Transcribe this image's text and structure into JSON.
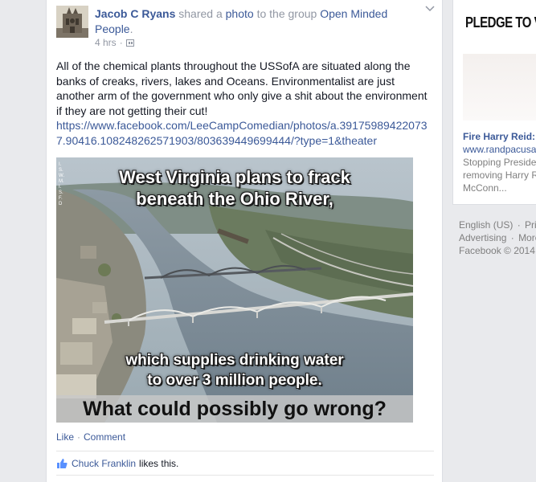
{
  "post": {
    "author": "Jacob C Ryans",
    "shared_text_1": "shared a",
    "photo_link": "photo",
    "shared_text_2": "to the group",
    "group_name": "Open Minded People",
    "group_suffix": ".",
    "time": "4 hrs",
    "body": "All of the chemical plants throughout the USSofA are situated along the banks of creaks, rivers, lakes and Oceans. Environmentalist are just another arm of the government who only give a shit about the environment if they are not getting their cut!",
    "url": "https://www.facebook.com/LeeCampComedian/photos/a.391759894220737.90416.108248262571903/803639449699444/?type=1&theater",
    "icons": {
      "chevron": "chevron-down-icon",
      "audience": "group-audience-icon",
      "like": "thumbs-up-icon"
    }
  },
  "photo": {
    "headline_line1": "West Virginia plans to frack",
    "headline_line2": "beneath the Ohio River,",
    "subtext_line1": "which supplies drinking water",
    "subtext_line2": "to over 3 million people.",
    "tagline": "What could possibly go wrong?",
    "watermark": "I.S.W.M.I.S.F.D"
  },
  "actions": {
    "like": "Like",
    "separator": "·",
    "comment": "Comment"
  },
  "likes": {
    "liker": "Chuck Franklin",
    "suffix": "likes this."
  },
  "sidebar_ad": {
    "image_text": "PLEDGE TO VOTE",
    "title": "Fire Harry Reid:",
    "url": "www.randpacusa",
    "desc_line1": "Stopping Preside",
    "desc_line2": "removing Harry R",
    "desc_line3": "McConn..."
  },
  "footer": {
    "language": "English (US)",
    "privacy": "Priv",
    "advertising": "Advertising",
    "more": "More",
    "copyright": "Facebook © 2014",
    "separator": "·"
  },
  "colors": {
    "link": "#3b5998",
    "background": "#e9eaed",
    "meta_gray": "#9197a3"
  }
}
